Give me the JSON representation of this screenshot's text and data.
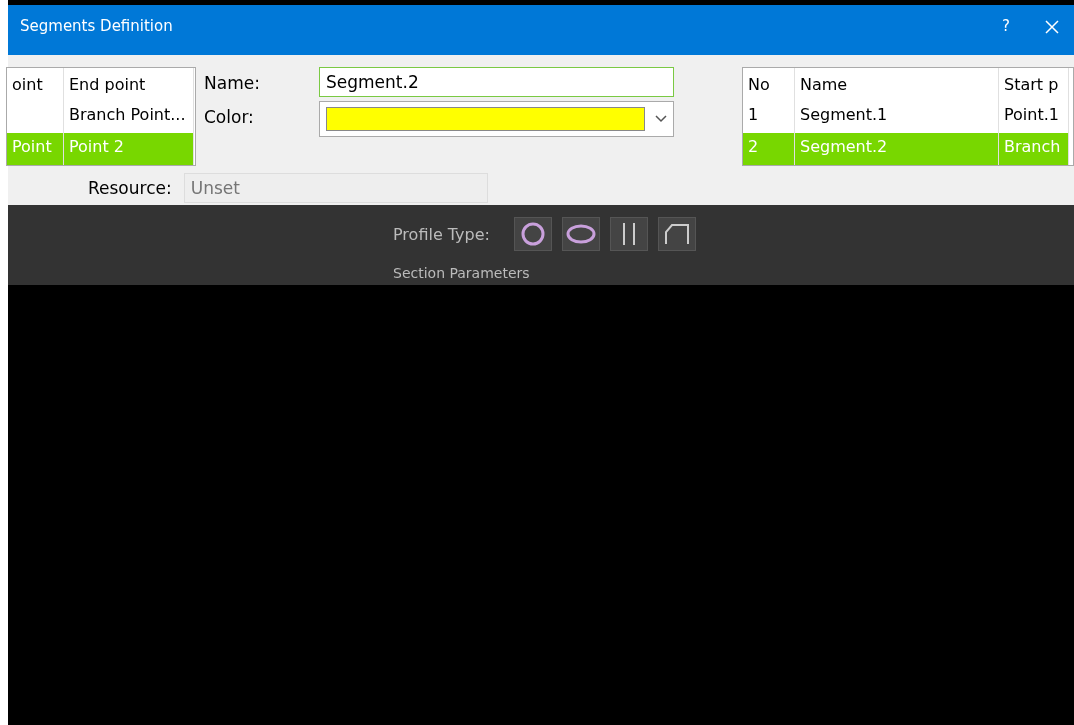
{
  "window": {
    "title": "Segments Definition",
    "help": "?"
  },
  "left_table": {
    "columns": [
      "oint",
      "End point"
    ],
    "rows": [
      {
        "cells": [
          "",
          "Branch Point..."
        ],
        "selected": false
      },
      {
        "cells": [
          "Point",
          "Point 2"
        ],
        "selected": true
      }
    ]
  },
  "form": {
    "name": {
      "label": "Name:",
      "value": "Segment.2"
    },
    "color": {
      "label": "Color:",
      "color": "#ffff00"
    },
    "resource": {
      "label": "Resource:",
      "placeholder": "Unset"
    }
  },
  "right_table": {
    "columns": [
      "No",
      "Name",
      "Start p"
    ],
    "rows": [
      {
        "cells": [
          "1",
          "Segment.1",
          "Point.1"
        ],
        "selected": false
      },
      {
        "cells": [
          "2",
          "Segment.2",
          "Branch"
        ],
        "selected": true
      }
    ]
  },
  "profile": {
    "label": "Profile Type:",
    "options": [
      {
        "kind": "circle"
      },
      {
        "kind": "ring"
      },
      {
        "kind": "bars"
      },
      {
        "kind": "trapezoid"
      }
    ],
    "section_label": "Section Parameters"
  }
}
